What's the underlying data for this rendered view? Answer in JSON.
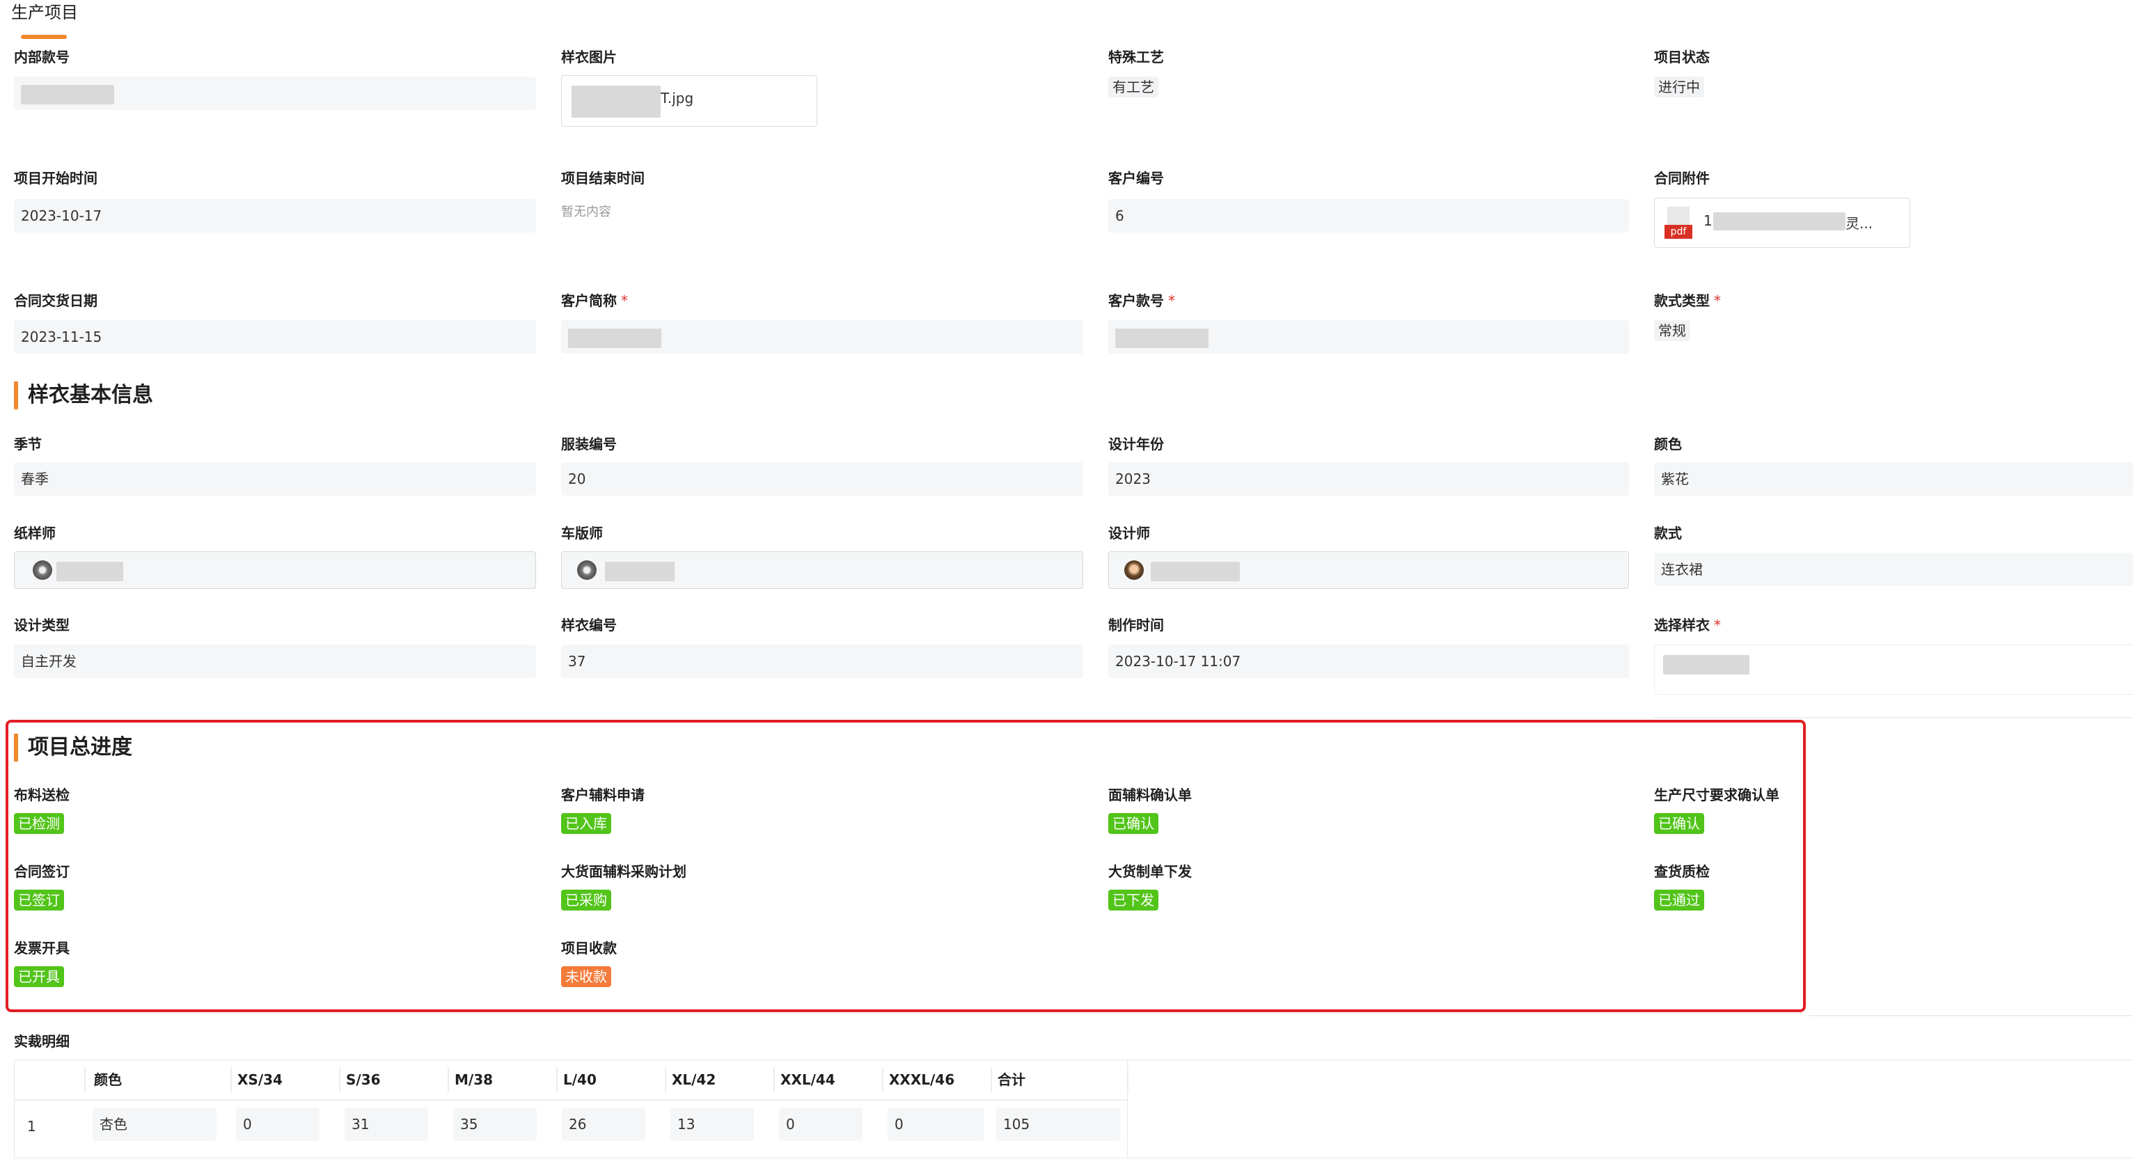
{
  "tab": {
    "title": "生产项目"
  },
  "project": {
    "internal_no": {
      "label": "内部款号"
    },
    "sample_image": {
      "label": "样衣图片",
      "file_suffix": "T.jpg"
    },
    "special_craft": {
      "label": "特殊工艺",
      "value": "有工艺"
    },
    "status": {
      "label": "项目状态",
      "value": "进行中"
    },
    "start_time": {
      "label": "项目开始时间",
      "value": "2023-10-17"
    },
    "end_time": {
      "label": "项目结束时间",
      "value": "暂无内容"
    },
    "customer_no": {
      "label": "客户编号",
      "value": "6"
    },
    "contract_attach": {
      "label": "合同附件",
      "file_prefix": "1",
      "file_suffix": "灵...",
      "icon_text": "pdf"
    },
    "delivery_date": {
      "label": "合同交货日期",
      "value": "2023-11-15"
    },
    "customer_short": {
      "label": "客户简称",
      "required": "*"
    },
    "customer_style": {
      "label": "客户款号",
      "required": "*"
    },
    "style_type": {
      "label": "款式类型",
      "required": "*",
      "value": "常规"
    }
  },
  "sample": {
    "section_title": "样衣基本信息",
    "season": {
      "label": "季节",
      "value": "春季"
    },
    "garment_no": {
      "label": "服装编号",
      "value": "20"
    },
    "design_year": {
      "label": "设计年份",
      "value": "2023"
    },
    "color": {
      "label": "颜色",
      "value": "紫花"
    },
    "pattern_maker": {
      "label": "纸样师"
    },
    "sample_maker": {
      "label": "车版师"
    },
    "designer": {
      "label": "设计师"
    },
    "style": {
      "label": "款式",
      "value": "连衣裙"
    },
    "design_type": {
      "label": "设计类型",
      "value": "自主开发"
    },
    "sample_no": {
      "label": "样衣编号",
      "value": "37"
    },
    "make_time": {
      "label": "制作时间",
      "value": "2023-10-17 11:07"
    },
    "select_sample": {
      "label": "选择样衣",
      "required": "*"
    }
  },
  "progress": {
    "section_title": "项目总进度",
    "items": [
      {
        "label": "布料送检",
        "status": "已检测",
        "color": "#52c41a"
      },
      {
        "label": "客户辅料申请",
        "status": "已入库",
        "color": "#52c41a"
      },
      {
        "label": "面辅料确认单",
        "status": "已确认",
        "color": "#52c41a"
      },
      {
        "label": "生产尺寸要求确认单",
        "status": "已确认",
        "color": "#52c41a"
      },
      {
        "label": "合同签订",
        "status": "已签订",
        "color": "#52c41a"
      },
      {
        "label": "大货面辅料采购计划",
        "status": "已采购",
        "color": "#52c41a"
      },
      {
        "label": "大货制单下发",
        "status": "已下发",
        "color": "#52c41a"
      },
      {
        "label": "查货质检",
        "status": "已通过",
        "color": "#52c41a"
      },
      {
        "label": "发票开具",
        "status": "已开具",
        "color": "#52c41a"
      },
      {
        "label": "项目收款",
        "status": "未收款",
        "color": "#f47b3a"
      }
    ]
  },
  "cutting": {
    "title": "实裁明细",
    "headers": [
      "颜色",
      "XS/34",
      "S/36",
      "M/38",
      "L/40",
      "XL/42",
      "XXL/44",
      "XXXL/46",
      "合计"
    ],
    "rows": [
      {
        "index": "1",
        "cells": [
          "杏色",
          "0",
          "31",
          "35",
          "26",
          "13",
          "0",
          "0",
          "105"
        ]
      }
    ]
  }
}
